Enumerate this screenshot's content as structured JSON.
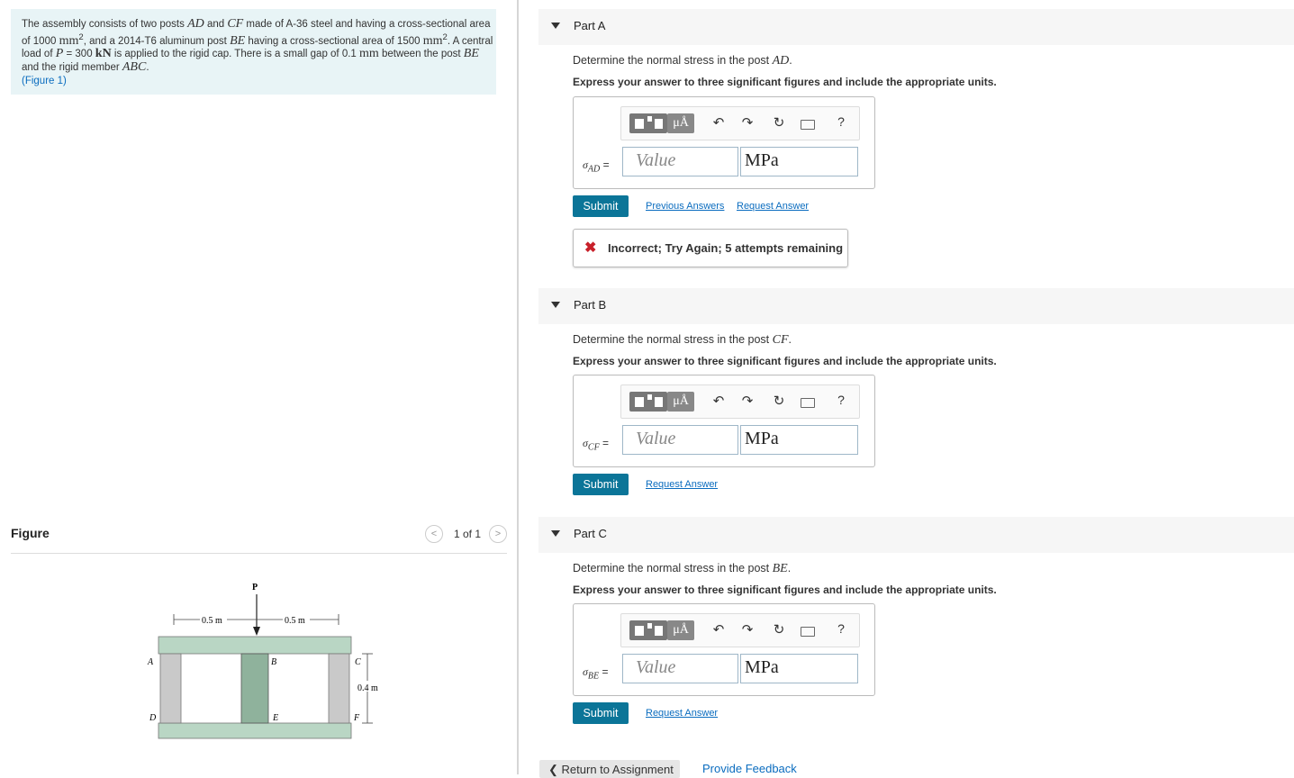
{
  "problem": {
    "text_1": "The assembly consists of two posts ",
    "var_AD": "AD",
    "text_2": " and ",
    "var_CF": "CF",
    "text_3": " made of A-36 steel and having a cross-sectional area of 1000 ",
    "unit_mm2_a": "mm",
    "text_4": ", and a 2014-T6 aluminum post ",
    "var_BE": "BE",
    "text_5": " having a cross-sectional area of 1500 ",
    "unit_mm2_b": "mm",
    "text_6": ". A central load of ",
    "var_P": "P",
    "text_7": " = 300  ",
    "unit_kN": "kN",
    "text_8": " is applied to the rigid cap. There is a small gap of 0.1 ",
    "unit_mm": "mm",
    "text_9": " between the post ",
    "var_BE2": "BE",
    "text_10": " and the rigid member ",
    "var_ABC": "ABC",
    "text_11": ".",
    "figure_link": "(Figure 1)"
  },
  "figure": {
    "title": "Figure",
    "pager": "1 of 1",
    "labels": {
      "P": "P",
      "A": "A",
      "B": "B",
      "C": "C",
      "D": "D",
      "E": "E",
      "F": "F",
      "dim_left": "0.5 m",
      "dim_right": "0.5 m",
      "dim_height": "0.4 m"
    },
    "colors": {
      "cap": "#b9d6c4",
      "post_steel": "#c9c9c9",
      "post_alu": "#8fb29c"
    }
  },
  "parts": [
    {
      "label": "Part A",
      "question": "Determine the normal stress in the post ",
      "question_var": "AD",
      "instruction": "Express your answer to three significant figures and include the appropriate units.",
      "symbol_sigma": "σ",
      "symbol_sub": "AD",
      "eq": " =",
      "value_placeholder": "Value",
      "units": "MPa",
      "submit": "Submit",
      "link1": "Previous Answers",
      "link2": "Request Answer",
      "feedback": "Incorrect; Try Again; 5 attempts remaining"
    },
    {
      "label": "Part B",
      "question": "Determine the normal stress in the post ",
      "question_var": "CF",
      "instruction": "Express your answer to three significant figures and include the appropriate units.",
      "symbol_sigma": "σ",
      "symbol_sub": "CF",
      "eq": " =",
      "value_placeholder": "Value",
      "units": "MPa",
      "submit": "Submit",
      "link1": "Request Answer"
    },
    {
      "label": "Part C",
      "question": "Determine the normal stress in the post ",
      "question_var": "BE",
      "instruction": "Express your answer to three significant figures and include the appropriate units.",
      "symbol_sigma": "σ",
      "symbol_sub": "BE",
      "eq": " =",
      "value_placeholder": "Value",
      "units": "MPa",
      "submit": "Submit",
      "link1": "Request Answer"
    }
  ],
  "toolbar": {
    "mu_label": "μÅ",
    "help": "?",
    "undo": "↶",
    "redo": "↷",
    "reset": "↻"
  },
  "footer": {
    "return": "Return to Assignment",
    "return_icon": "❮",
    "feedback": "Provide Feedback"
  }
}
